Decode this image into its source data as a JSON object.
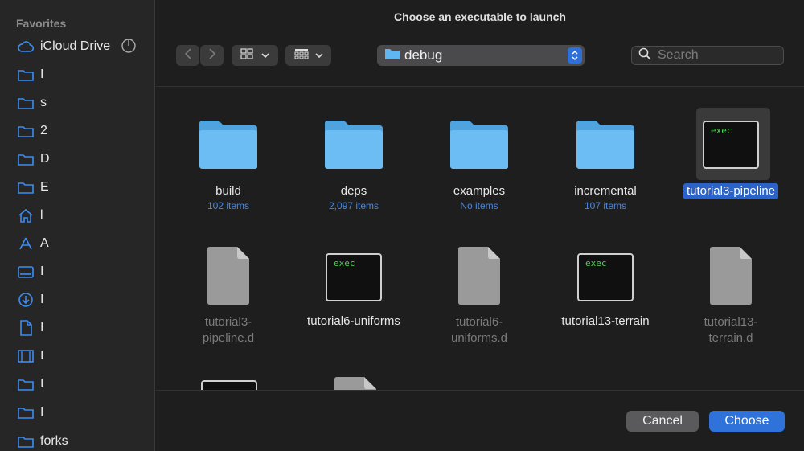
{
  "dialog_title": "Choose an executable to launch",
  "sidebar": {
    "header": "Favorites",
    "items": [
      {
        "label": "iCloud Drive",
        "icon": "cloud-icon"
      },
      {
        "label": "I",
        "icon": "folder-icon"
      },
      {
        "label": "s",
        "icon": "folder-icon"
      },
      {
        "label": "2",
        "icon": "folder-icon"
      },
      {
        "label": "D",
        "icon": "folder-icon"
      },
      {
        "label": "E",
        "icon": "folder-icon"
      },
      {
        "label": "l",
        "icon": "home-icon"
      },
      {
        "label": "A",
        "icon": "applications-icon"
      },
      {
        "label": "I",
        "icon": "desktop-icon"
      },
      {
        "label": "I",
        "icon": "downloads-icon"
      },
      {
        "label": "I",
        "icon": "document-icon"
      },
      {
        "label": "I",
        "icon": "film-icon"
      },
      {
        "label": "I",
        "icon": "folder-icon"
      },
      {
        "label": "I",
        "icon": "folder-icon"
      },
      {
        "label": "forks",
        "icon": "folder-icon"
      }
    ]
  },
  "toolbar": {
    "back_icon": "chevron-left-icon",
    "forward_icon": "chevron-right-icon",
    "view_icon": "grid-icon",
    "group_icon": "group-grid-icon",
    "path": "debug"
  },
  "search": {
    "placeholder": "Search"
  },
  "files": [
    {
      "name": "build",
      "sub": "102 items",
      "kind": "folder"
    },
    {
      "name": "deps",
      "sub": "2,097 items",
      "kind": "folder"
    },
    {
      "name": "examples",
      "sub": "No items",
      "kind": "folder"
    },
    {
      "name": "incremental",
      "sub": "107 items",
      "kind": "folder"
    },
    {
      "name": "tutorial3-pipeline",
      "sub": "",
      "kind": "exec",
      "selected": true
    },
    {
      "name": "tutorial3-\npipeline.d",
      "sub": "",
      "kind": "doc"
    },
    {
      "name": "tutorial6-uniforms",
      "sub": "",
      "kind": "exec"
    },
    {
      "name": "tutorial6-\nuniforms.d",
      "sub": "",
      "kind": "doc"
    },
    {
      "name": "tutorial13-terrain",
      "sub": "",
      "kind": "exec"
    },
    {
      "name": "tutorial13-\nterrain.d",
      "sub": "",
      "kind": "doc"
    }
  ],
  "exec_label": "exec",
  "buttons": {
    "cancel": "Cancel",
    "choose": "Choose"
  },
  "colors": {
    "accent": "#2f72da",
    "folder": "#5fb6f0"
  }
}
